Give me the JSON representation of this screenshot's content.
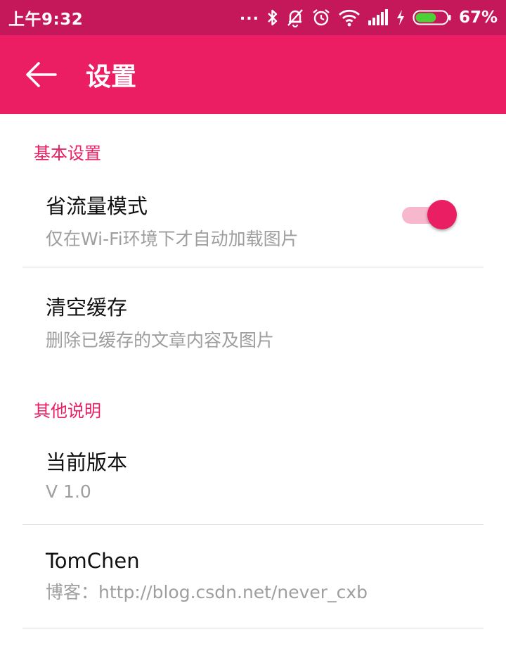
{
  "status_bar": {
    "time": "上午9:32",
    "dots": "...",
    "battery_percent": "67%",
    "icons": [
      "bluetooth-icon",
      "notifications-off-icon",
      "alarm-icon",
      "wifi-icon",
      "signal-icon",
      "charging-icon",
      "battery-icon"
    ],
    "battery_level": 0.67,
    "battery_color": "#4cd137"
  },
  "app_bar": {
    "title": "设置",
    "back_icon": "arrow-left-icon",
    "color": "#eb1d63"
  },
  "sections": [
    {
      "header": "基本设置",
      "items": [
        {
          "title": "省流量模式",
          "summary": "仅在Wi-Fi环境下才自动加载图片",
          "toggle_on": true
        },
        {
          "title": "清空缓存",
          "summary": "删除已缓存的文章内容及图片"
        }
      ]
    },
    {
      "header": "其他说明",
      "items": [
        {
          "title": "当前版本",
          "summary": "V 1.0"
        },
        {
          "title": "TomChen",
          "summary": "博客：http://blog.csdn.net/never_cxb"
        }
      ]
    }
  ],
  "accent_color": "#e91e63"
}
